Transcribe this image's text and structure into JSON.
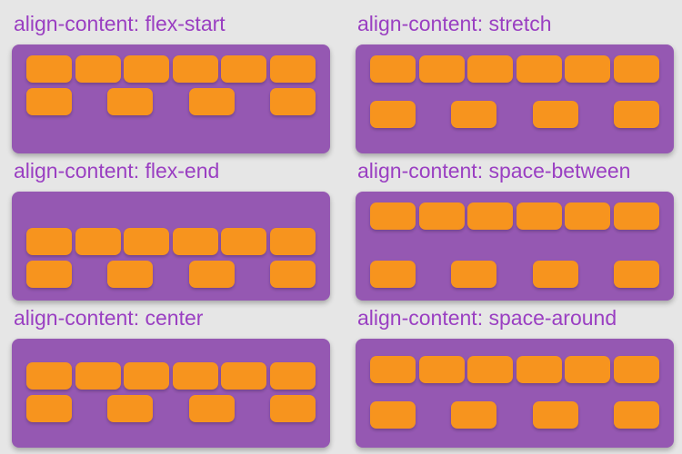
{
  "panels": [
    {
      "title": "align-content: flex-start",
      "align_content": "flex-start",
      "item_count": 10
    },
    {
      "title": "align-content: stretch",
      "align_content": "stretch",
      "item_count": 10
    },
    {
      "title": "align-content: flex-end",
      "align_content": "flex-end",
      "item_count": 10
    },
    {
      "title": "align-content: space-between",
      "align_content": "space-between",
      "item_count": 10
    },
    {
      "title": "align-content: center",
      "align_content": "center",
      "item_count": 10
    },
    {
      "title": "align-content: space-around",
      "align_content": "space-around",
      "item_count": 10
    }
  ],
  "colors": {
    "background": "#e6e6e6",
    "title": "#9a3fc2",
    "container": "#9558b2",
    "item": "#f7941e"
  }
}
